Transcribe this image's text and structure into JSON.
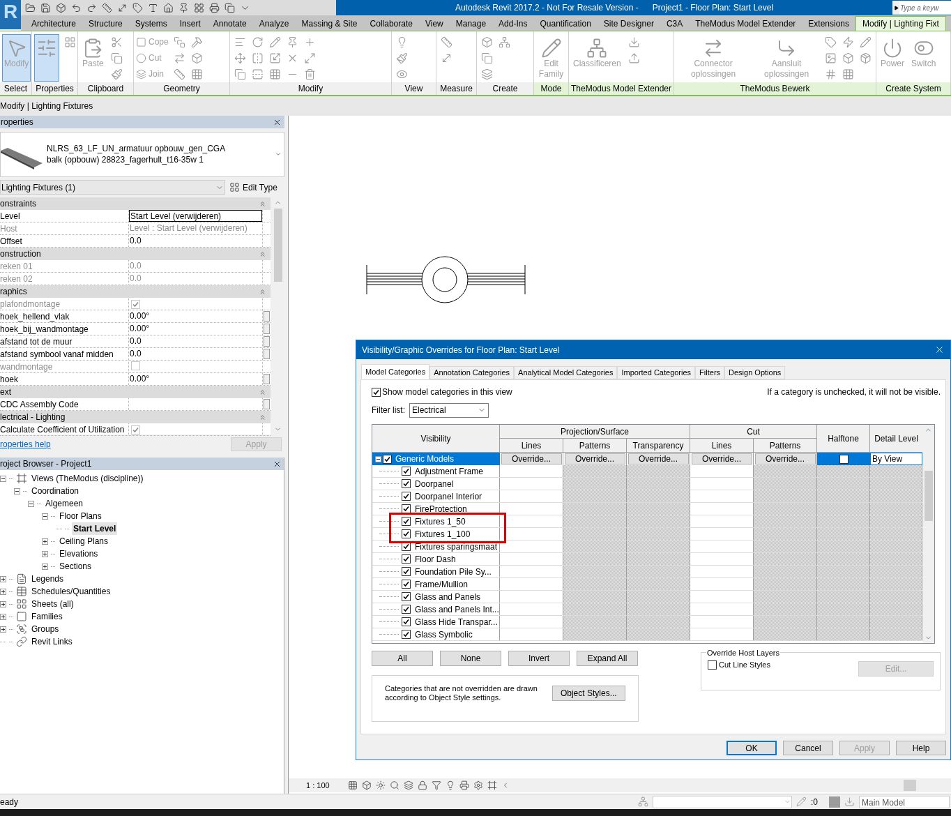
{
  "app": {
    "logo": "R",
    "title": "Autodesk Revit 2017.2 - Not For Resale Version -",
    "document": "Project1 - Floor Plan: Start Level",
    "search": {
      "placeholder": "Type a keyw"
    }
  },
  "ribbon_tabs": [
    {
      "label": "Architecture",
      "selected": false
    },
    {
      "label": "Structure",
      "selected": false
    },
    {
      "label": "Systems",
      "selected": false
    },
    {
      "label": "Insert",
      "selected": false
    },
    {
      "label": "Annotate",
      "selected": false
    },
    {
      "label": "Analyze",
      "selected": false
    },
    {
      "label": "Massing & Site",
      "selected": false
    },
    {
      "label": "Collaborate",
      "selected": false
    },
    {
      "label": "View",
      "selected": false
    },
    {
      "label": "Manage",
      "selected": false
    },
    {
      "label": "Add-Ins",
      "selected": false
    },
    {
      "label": "Quantification",
      "selected": false
    },
    {
      "label": "Site Designer",
      "selected": false
    },
    {
      "label": "C3A",
      "selected": false
    },
    {
      "label": "TheModus Model Extender",
      "selected": false
    },
    {
      "label": "Extensions",
      "selected": false
    },
    {
      "label": "Modify | Lighting Fixt",
      "selected": true
    }
  ],
  "ribbon_panels": [
    {
      "label": "Select",
      "contextual": false,
      "tools": [
        {
          "kind": "large",
          "label": "Modify",
          "selected": true
        }
      ]
    },
    {
      "label": "Properties",
      "contextual": false,
      "tools": [
        {
          "kind": "large",
          "selected": true
        }
      ]
    },
    {
      "label": "Clipboard",
      "contextual": false,
      "tools": [
        {
          "kind": "large",
          "label": "Paste",
          "selected": false
        }
      ]
    },
    {
      "label": "Geometry",
      "contextual": false,
      "tools": [
        {
          "kind": "small",
          "label": "Cope",
          "selected": false
        },
        {
          "kind": "small",
          "label": "Cut",
          "selected": false
        },
        {
          "kind": "small",
          "label": "Join",
          "selected": false
        }
      ]
    },
    {
      "label": "Modify",
      "contextual": false
    },
    {
      "label": "View",
      "contextual": false
    },
    {
      "label": "Measure",
      "contextual": false
    },
    {
      "label": "Create",
      "contextual": false
    },
    {
      "label": "Mode",
      "contextual": true,
      "tools": [
        {
          "kind": "large",
          "label": "Edit Family",
          "selected": false
        }
      ]
    },
    {
      "label": "TheModus Model Extender",
      "contextual": true,
      "tools": [
        {
          "kind": "large",
          "label": "Classificeren",
          "selected": false
        }
      ]
    },
    {
      "label": "TheModus Bewerk",
      "contextual": true,
      "tools": [
        {
          "kind": "large",
          "label": "Connector oplossingen",
          "selected": false
        },
        {
          "kind": "large",
          "label": "Aansluit oplossingen",
          "selected": false
        }
      ]
    },
    {
      "label": "Create System",
      "contextual": true,
      "tools": [
        {
          "kind": "large",
          "label": "Power",
          "selected": false
        },
        {
          "kind": "large",
          "label": "Switch",
          "selected": false
        }
      ]
    }
  ],
  "context_bar": "Modify | Lighting Fixtures",
  "properties": {
    "title": "roperties",
    "type_name": "NLRS_63_LF_UN_armatuur opbouw_gen_CGA",
    "type_variant": "balk (opbouw) 28823_fagerhult_t16-35w 1",
    "instance_filter": "Lighting Fixtures (1)",
    "edit_type": "Edit Type",
    "groups": [
      {
        "name": "onstraints",
        "rows": [
          {
            "name": "Level",
            "kind": "text",
            "value": "Start Level (verwijderen)",
            "disabled": false,
            "editing": true,
            "assoc": false
          },
          {
            "name": "Host",
            "kind": "text",
            "value": "Level : Start Level (verwijderen)",
            "disabled": true,
            "assoc": false
          },
          {
            "name": "Offset",
            "kind": "text",
            "value": "0.0",
            "disabled": false,
            "assoc": false
          }
        ]
      },
      {
        "name": "onstruction",
        "rows": [
          {
            "name": "reken 01",
            "kind": "text",
            "value": "0.0",
            "disabled": true,
            "assoc": false
          },
          {
            "name": "reken 02",
            "kind": "text",
            "value": "0.0",
            "disabled": true,
            "assoc": false
          }
        ]
      },
      {
        "name": "raphics",
        "rows": [
          {
            "name": "plafondmontage",
            "kind": "checkbox",
            "checked": true,
            "disabled": true,
            "assoc": false
          },
          {
            "name": "hoek_hellend_vlak",
            "kind": "text",
            "value": "0.00°",
            "disabled": false,
            "assoc": true
          },
          {
            "name": "hoek_bij_wandmontage",
            "kind": "text",
            "value": "0.00°",
            "disabled": false,
            "assoc": true
          },
          {
            "name": "afstand tot de muur",
            "kind": "text",
            "value": "0.0",
            "disabled": false,
            "assoc": true
          },
          {
            "name": "afstand symbool vanaf midden",
            "kind": "text",
            "value": "0.0",
            "disabled": false,
            "assoc": true
          },
          {
            "name": "wandmontage",
            "kind": "checkbox",
            "checked": false,
            "disabled": true,
            "assoc": false
          },
          {
            "name": "hoek",
            "kind": "text",
            "value": "0.00°",
            "disabled": false,
            "assoc": true
          }
        ]
      },
      {
        "name": "ext",
        "rows": [
          {
            "name": "CDC Assembly Code",
            "kind": "text",
            "disabled": false,
            "assoc": true
          }
        ]
      },
      {
        "name": "lectrical - Lighting",
        "rows": [
          {
            "name": "Calculate Coefficient of Utilization",
            "kind": "checkbox",
            "checked": true,
            "disabled": false,
            "assoc": false
          }
        ]
      }
    ],
    "help": "roperties help",
    "apply": {
      "label": "Apply",
      "disabled": true
    }
  },
  "browser": {
    "title": "roject Browser - Project1",
    "tree": [
      {
        "label": "Views (TheModus (discipline))",
        "kind": "views",
        "expanded": true,
        "selected": false,
        "children": [
          {
            "label": "Coordination",
            "expanded": true,
            "selected": false,
            "children": [
              {
                "label": "Algemeen",
                "expanded": true,
                "selected": false,
                "children": [
                  {
                    "label": "Floor Plans",
                    "expanded": true,
                    "selected": false,
                    "children": [
                      {
                        "label": "Start Level",
                        "selected": true
                      }
                    ]
                  },
                  {
                    "label": "Ceiling Plans",
                    "expanded": false,
                    "selected": false
                  },
                  {
                    "label": "Elevations",
                    "expanded": false,
                    "selected": false
                  },
                  {
                    "label": "Sections",
                    "expanded": false,
                    "selected": false
                  }
                ]
              }
            ]
          }
        ]
      },
      {
        "label": "Legends",
        "kind": "legends",
        "expanded": false,
        "selected": false
      },
      {
        "label": "Schedules/Quantities",
        "kind": "schedules",
        "expanded": false,
        "selected": false
      },
      {
        "label": "Sheets (all)",
        "kind": "sheets",
        "expanded": false,
        "selected": false
      },
      {
        "label": "Families",
        "kind": "families",
        "expanded": false,
        "selected": false
      },
      {
        "label": "Groups",
        "kind": "groups",
        "expanded": false,
        "selected": false
      },
      {
        "label": "Revit Links",
        "kind": "links",
        "selected": false
      }
    ]
  },
  "dialog": {
    "title": "Visibility/Graphic Overrides for Floor Plan: Start Level",
    "tabs": [
      {
        "label": "Model Categories",
        "selected": true
      },
      {
        "label": "Annotation Categories",
        "selected": false
      },
      {
        "label": "Analytical Model Categories",
        "selected": false
      },
      {
        "label": "Imported Categories",
        "selected": false
      },
      {
        "label": "Filters",
        "selected": false
      },
      {
        "label": "Design Options",
        "selected": false
      }
    ],
    "show_categories": {
      "label": "Show model categories in this view",
      "checked": true
    },
    "note": "If a category is unchecked, it will not be visible.",
    "filter": {
      "label": "Filter list:",
      "value": "Electrical"
    },
    "columns": {
      "visibility": "Visibility",
      "projection": "Projection/Surface",
      "projection_sub": [
        "Lines",
        "Patterns",
        "Transparency"
      ],
      "cut": "Cut",
      "cut_sub": [
        "Lines",
        "Patterns"
      ],
      "halftone": "Halftone",
      "detail_level": "Detail Level"
    },
    "parent_row": {
      "name": "Generic Models",
      "checked": true,
      "expanded": true,
      "selected": true,
      "overrides": [
        "Override...",
        "Override...",
        "Override...",
        "Override...",
        "Override..."
      ],
      "halftone": false,
      "detail_level": "By View"
    },
    "rows": [
      {
        "name": "Adjustment Frame",
        "checked": true,
        "highlighted": false
      },
      {
        "name": "Doorpanel",
        "checked": true,
        "highlighted": false
      },
      {
        "name": "Doorpanel Interior",
        "checked": true,
        "highlighted": false
      },
      {
        "name": "FireProtection",
        "checked": true,
        "highlighted": false
      },
      {
        "name": "Fixtures 1_50",
        "checked": true,
        "highlighted": true
      },
      {
        "name": "Fixtures 1_100",
        "checked": true,
        "highlighted": true
      },
      {
        "name": "Fixtures sparingsmaat",
        "checked": true,
        "highlighted": false
      },
      {
        "name": "Floor Dash",
        "checked": true,
        "highlighted": false
      },
      {
        "name": "Foundation Pile Sy...",
        "checked": true,
        "highlighted": false
      },
      {
        "name": "Frame/Mullion",
        "checked": true,
        "highlighted": false
      },
      {
        "name": "Glass and Panels",
        "checked": true,
        "highlighted": false
      },
      {
        "name": "Glass and Panels Int...",
        "checked": true,
        "highlighted": false
      },
      {
        "name": "Glass Hide Transpar...",
        "checked": true,
        "highlighted": false
      },
      {
        "name": "Glass Symbolic",
        "checked": true,
        "highlighted": false
      }
    ],
    "buttons": [
      "All",
      "None",
      "Invert",
      "Expand All"
    ],
    "info": "Categories that are not overridden are drawn according to Object Style settings.",
    "object_styles": "Object Styles...",
    "host_layers": {
      "title": "Override Host Layers",
      "label": "Cut Line Styles",
      "checked": false,
      "edit": "Edit...",
      "edit_disabled": true
    },
    "footer": [
      {
        "label": "OK",
        "default": true,
        "disabled": false
      },
      {
        "label": "Cancel",
        "default": false,
        "disabled": false
      },
      {
        "label": "Apply",
        "default": false,
        "disabled": true
      },
      {
        "label": "Help",
        "default": false,
        "disabled": false
      }
    ]
  },
  "view_bar": {
    "scale": "1 : 100"
  },
  "status_bar": {
    "message": "eady",
    "selection_count": ":0",
    "model": "Main Model"
  }
}
